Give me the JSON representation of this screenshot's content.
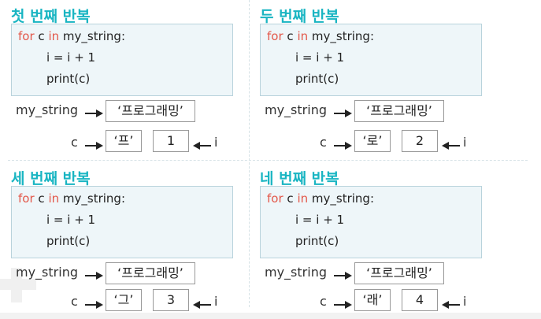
{
  "code": {
    "for_kw": "for",
    "loop_var": "c",
    "in_kw": "in",
    "iterable": "my_string:",
    "line2": "i = i + 1",
    "line3": "print(c)"
  },
  "labels": {
    "string_var": "my_string",
    "char_var": "c",
    "index_var": "i"
  },
  "string_value": "‘프로그래밍’",
  "iterations": [
    {
      "title": "첫 번째 반복",
      "char": "‘프’",
      "index": "1"
    },
    {
      "title": "두 번째 반복",
      "char": "‘로’",
      "index": "2"
    },
    {
      "title": "세 번째 반복",
      "char": "‘그’",
      "index": "3"
    },
    {
      "title": "네 번째 반복",
      "char": "‘래’",
      "index": "4"
    }
  ],
  "colors": {
    "title": "#19b5c2",
    "keyword": "#e3584a",
    "code_bg": "#eef6f9"
  }
}
